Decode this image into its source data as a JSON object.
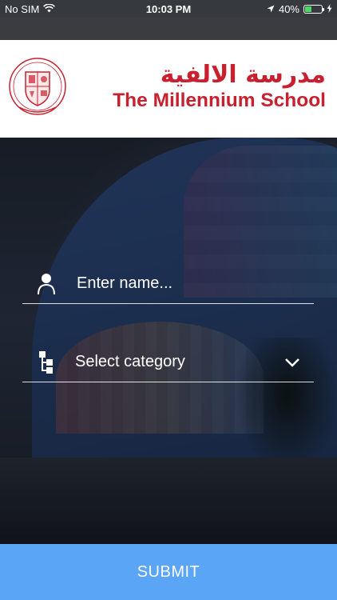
{
  "status_bar": {
    "carrier": "No SIM",
    "time": "10:03 PM",
    "battery": "40%",
    "battery_level": 0.4,
    "icons": [
      "wifi-icon",
      "location-arrow-icon",
      "battery-icon",
      "charging-bolt-icon"
    ]
  },
  "header": {
    "arabic_name": "مدرسة الالفية",
    "english_name": "The Millennium School",
    "brand_color": "#c8202f"
  },
  "form": {
    "name_placeholder": "Enter name...",
    "name_value": "",
    "category_selected": "Select category",
    "icons": {
      "name": "person-icon",
      "category": "hierarchy-icon",
      "dropdown": "chevron-down-icon"
    }
  },
  "submit": {
    "label": "SUBMIT",
    "color": "#5aa5f5"
  }
}
